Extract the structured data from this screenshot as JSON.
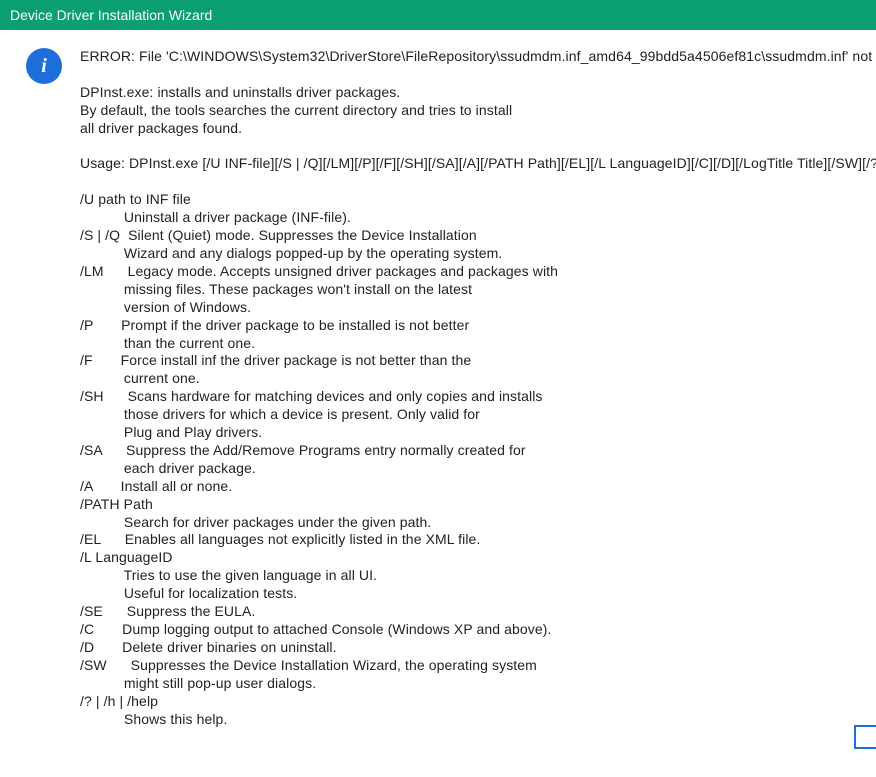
{
  "titlebar": {
    "title": "Device Driver Installation Wizard"
  },
  "icon": {
    "glyph": "i",
    "name": "info-icon"
  },
  "message": {
    "error_line": "ERROR: File 'C:\\WINDOWS\\System32\\DriverStore\\FileRepository\\ssudmdm.inf_amd64_99bdd5a4506ef81c\\ssudmdm.inf' not fo",
    "blank1": "",
    "dpinst_1": "DPInst.exe: installs and uninstalls driver packages.",
    "dpinst_2": "By default, the tools searches the current directory and tries to install",
    "dpinst_3": "all driver packages found.",
    "blank2": "",
    "usage": "Usage: DPInst.exe [/U INF-file][/S | /Q][/LM][/P][/F][/SH][/SA][/A][/PATH Path][/EL][/L LanguageID][/C][/D][/LogTitle Title][/SW][/? | /h",
    "blank3": "",
    "opt_u1": "/U path to INF file",
    "opt_u2": "           Uninstall a driver package (INF-file).",
    "opt_sq1": "/S | /Q  Silent (Quiet) mode. Suppresses the Device Installation",
    "opt_sq2": "           Wizard and any dialogs popped-up by the operating system.",
    "opt_lm1": "/LM      Legacy mode. Accepts unsigned driver packages and packages with",
    "opt_lm2": "           missing files. These packages won't install on the latest",
    "opt_lm3": "           version of Windows.",
    "opt_p1": "/P       Prompt if the driver package to be installed is not better",
    "opt_p2": "           than the current one.",
    "opt_f1": "/F       Force install inf the driver package is not better than the",
    "opt_f2": "           current one.",
    "opt_sh1": "/SH      Scans hardware for matching devices and only copies and installs",
    "opt_sh2": "           those drivers for which a device is present. Only valid for",
    "opt_sh3": "           Plug and Play drivers.",
    "opt_sa1": "/SA      Suppress the Add/Remove Programs entry normally created for",
    "opt_sa2": "           each driver package.",
    "opt_a": "/A       Install all or none.",
    "opt_path1": "/PATH Path",
    "opt_path2": "           Search for driver packages under the given path.",
    "opt_el": "/EL      Enables all languages not explicitly listed in the XML file.",
    "opt_l1": "/L LanguageID",
    "opt_l2": "           Tries to use the given language in all UI.",
    "opt_l3": "           Useful for localization tests.",
    "opt_se": "/SE      Suppress the EULA.",
    "opt_c": "/C       Dump logging output to attached Console (Windows XP and above).",
    "opt_d": "/D       Delete driver binaries on uninstall.",
    "opt_sw1": "/SW      Suppresses the Device Installation Wizard, the operating system",
    "opt_sw2": "           might still pop-up user dialogs.",
    "opt_h1": "/? | /h | /help",
    "opt_h2": "           Shows this help."
  }
}
